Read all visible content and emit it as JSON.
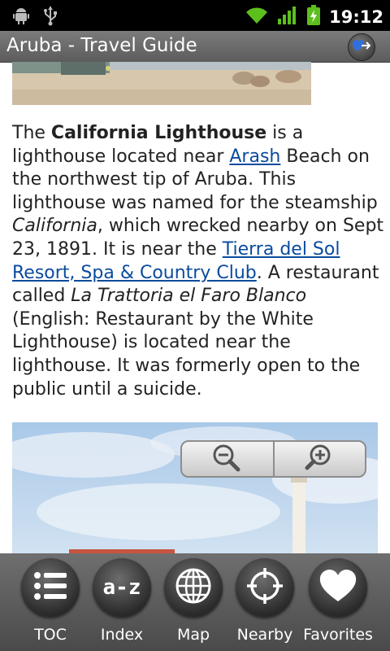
{
  "status_bar": {
    "time": "19:12",
    "icons": [
      "android-debug-icon",
      "usb-icon",
      "wifi-icon",
      "signal-icon",
      "battery-charging-icon"
    ]
  },
  "title_bar": {
    "title": "Aruba - Travel Guide",
    "action_icon": "favorites-heart-icon"
  },
  "article": {
    "p1": "The ",
    "bold1": "California Lighthouse",
    "p2": " is a lighthouse located near ",
    "link1": "Arash",
    "p3": " Beach on the northwest tip of Aruba. This lighthouse was named for the steamship ",
    "italic1": "California",
    "p4": ", which wrecked nearby on Sept 23, 1891. It is near the ",
    "link2": "Tierra del Sol Resort, Spa & Country Club",
    "p5": ". A restaurant called ",
    "italic2": "La Trattoria el Faro Blanco",
    "p6": " (English: Restaurant by the White Lighthouse) is located near the lighthouse. It was formerly open to the public until a suicide.",
    "link_color": "#0a4b9e"
  },
  "zoom_control": {
    "zoom_out_icon": "zoom-out-icon",
    "zoom_in_icon": "zoom-in-icon"
  },
  "bottom_nav": {
    "items": [
      {
        "label": "TOC",
        "icon": "list-icon"
      },
      {
        "label": "Index",
        "icon": "a-z-icon"
      },
      {
        "label": "Map",
        "icon": "globe-icon"
      },
      {
        "label": "Nearby",
        "icon": "crosshair-icon"
      },
      {
        "label": "Favorites",
        "icon": "heart-icon"
      }
    ],
    "index_glyph": "a-z"
  }
}
